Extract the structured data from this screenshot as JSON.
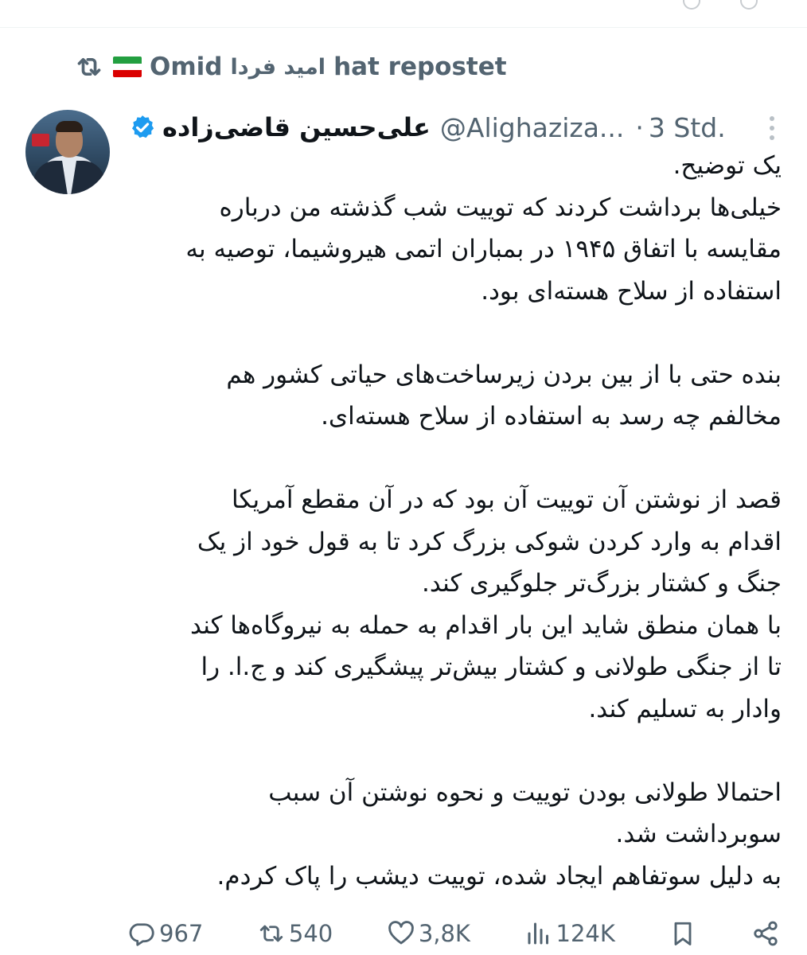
{
  "repost": {
    "user": "Omid",
    "user_persian": "امید فردا",
    "suffix": "hat repostet",
    "icon": "repost-icon",
    "flag": [
      "#239f40",
      "#ffffff",
      "#da0000"
    ]
  },
  "tweet": {
    "author_name": "علی‌حسین قاضی‌زاده",
    "handle": "@Alighaziza...",
    "separator": "·",
    "time": "3 Std.",
    "verified_color": "#1d9bf0",
    "lines": [
      "یک توضیح.",
      "خیلی‌ها برداشت کردند که توییت شب گذشته من درباره",
      "مقایسه با اتفاق ۱۹۴۵ در بمباران اتمی هیروشیما، توصیه به",
      "استفاده از سلاح هسته‌ای بود.",
      "",
      "بنده حتی با از بین بردن زیرساخت‌های حیاتی کشور هم",
      "مخالفم چه رسد به استفاده از سلاح هسته‌ای.",
      "",
      "قصد از نوشتن آن توییت آن بود که در آن مقطع آمریکا",
      "اقدام به وارد کردن شوکی بزرگ کرد تا به قول خود از یک",
      "جنگ و کشتار بزرگ‌تر جلوگیری کند.",
      "با همان منطق شاید این بار اقدام به حمله به نیروگاه‌ها کند",
      "تا از جنگی طولانی و کشتار بیش‌تر پیشگیری کند و ج.ا. را",
      "وادار به تسلیم کند.",
      "",
      "احتمالا طولانی بودن توییت و نحوه نوشتن آن سبب",
      "سوبرداشت شد.",
      "به دلیل سوتفاهم ایجاد شده، توییت دیشب را پاک کردم."
    ]
  },
  "actions": {
    "replies": "967",
    "reposts": "540",
    "likes": "3,8K",
    "views": "124K"
  }
}
